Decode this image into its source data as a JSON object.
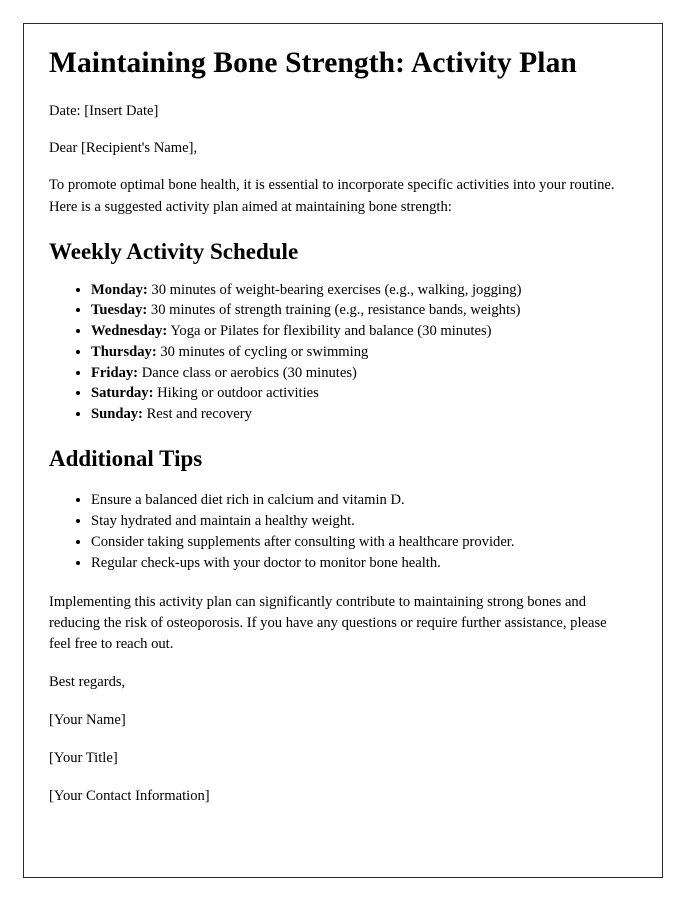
{
  "document": {
    "title": "Maintaining Bone Strength: Activity Plan",
    "date_line": "Date: [Insert Date]",
    "salutation": "Dear [Recipient's Name],",
    "intro_paragraph": "To promote optimal bone health, it is essential to incorporate specific activities into your routine. Here is a suggested activity plan aimed at maintaining bone strength:",
    "schedule_section": {
      "heading": "Weekly Activity Schedule",
      "items": [
        {
          "label": "Monday:",
          "text": "30 minutes of weight-bearing exercises (e.g., walking, jogging)"
        },
        {
          "label": "Tuesday:",
          "text": "30 minutes of strength training (e.g., resistance bands, weights)"
        },
        {
          "label": "Wednesday:",
          "text": "Yoga or Pilates for flexibility and balance (30 minutes)"
        },
        {
          "label": "Thursday:",
          "text": "30 minutes of cycling or swimming"
        },
        {
          "label": "Friday:",
          "text": "Dance class or aerobics (30 minutes)"
        },
        {
          "label": "Saturday:",
          "text": "Hiking or outdoor activities"
        },
        {
          "label": "Sunday:",
          "text": "Rest and recovery"
        }
      ]
    },
    "tips_section": {
      "heading": "Additional Tips",
      "items": [
        {
          "text": "Ensure a balanced diet rich in calcium and vitamin D."
        },
        {
          "text": "Stay hydrated and maintain a healthy weight."
        },
        {
          "text": "Consider taking supplements after consulting with a healthcare provider."
        },
        {
          "text": "Regular check-ups with your doctor to monitor bone health."
        }
      ]
    },
    "closing_paragraph": "Implementing this activity plan can significantly contribute to maintaining strong bones and reducing the risk of osteoporosis. If you have any questions or require further assistance, please feel free to reach out.",
    "sign_off": "Best regards,",
    "signature_lines": [
      "[Your Name]",
      "[Your Title]",
      "[Your Contact Information]"
    ]
  },
  "colors": {
    "page_background": "#ffffff",
    "text": "#000000",
    "border": "#2b2b2b"
  }
}
